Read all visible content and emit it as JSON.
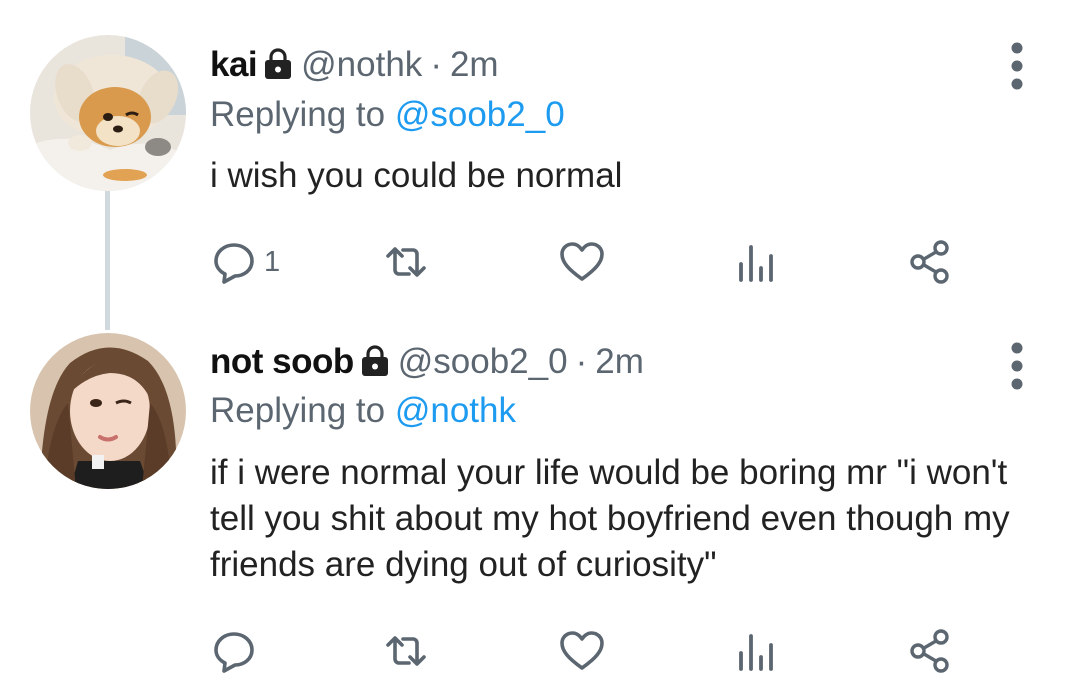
{
  "tweets": [
    {
      "display_name": "kai",
      "handle": "@nothk",
      "separator": "·",
      "time": "2m",
      "replying_prefix": "Replying to",
      "replying_to": "@soob2_0",
      "text": "i wish you could be normal",
      "reply_count": "1",
      "avatar": "shiba-inu-dog-photo",
      "locked": true
    },
    {
      "display_name": "not soob",
      "handle": "@soob2_0",
      "separator": "·",
      "time": "2m",
      "replying_prefix": "Replying to",
      "replying_to": "@nothk",
      "text": "if i were normal your life would be boring mr \"i won't tell you shit about my hot boyfriend even though my friends are dying out of curiosity\"",
      "reply_count": "",
      "avatar": "person-winking-photo",
      "locked": true
    }
  ],
  "actions": [
    "reply-icon",
    "retweet-icon",
    "like-icon",
    "views-icon",
    "share-icon"
  ],
  "colors": {
    "accent": "#1d9bf0",
    "secondary_text": "#5b6670",
    "icon": "#5b6670",
    "thread_line": "#cfd9de"
  }
}
